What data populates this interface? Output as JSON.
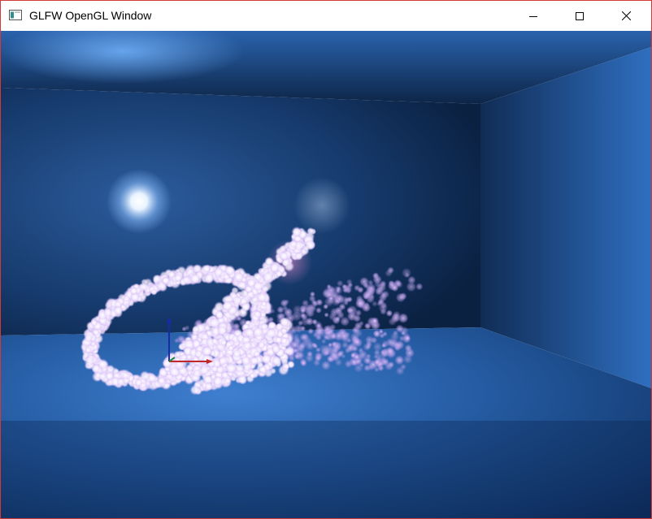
{
  "window": {
    "title": "GLFW OpenGL Window",
    "app_icon": "glfw-app-icon",
    "controls": {
      "minimize_icon": "minimize-icon",
      "maximize_icon": "maximize-icon",
      "close_icon": "close-icon"
    },
    "border_color": "#d23a3a"
  },
  "scene": {
    "description_colors": {
      "room_back_wall": "#12325e",
      "room_floor": "#1d4f93",
      "particle_core": "#ffffff",
      "particle_glow": "#c9a8f2"
    },
    "axis_gizmo": {
      "x_color": "#c0282a",
      "y_color": "#1b2aa6",
      "z_color": "#1c8a3a"
    }
  }
}
